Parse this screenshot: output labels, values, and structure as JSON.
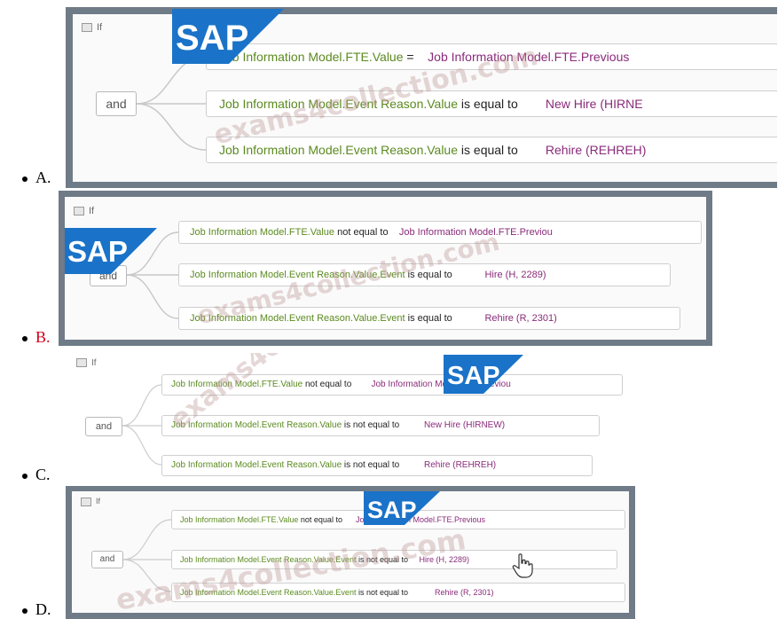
{
  "options": [
    {
      "letter": "A.",
      "if_label": "If",
      "and_label": "and",
      "rows": [
        {
          "field": "Job Information Model.FTE.Value",
          "op": " =",
          "value": "Job Information Model.FTE.Previous"
        },
        {
          "field": "Job Information Model.Event Reason.Value",
          "op": " is equal to",
          "value": "New Hire (HIRNE"
        },
        {
          "field": "Job Information Model.Event Reason.Value",
          "op": " is equal to",
          "value": "Rehire (REHREH)"
        }
      ]
    },
    {
      "letter": "B.",
      "if_label": "If",
      "and_label": "and",
      "rows": [
        {
          "field": "Job Information Model.FTE.Value",
          "op": " not equal to",
          "value": "Job Information Model.FTE.Previou"
        },
        {
          "field": "Job Information Model.Event Reason.Value.Event",
          "op": " is equal to",
          "value": "Hire (H, 2289)"
        },
        {
          "field": "Job Information Model.Event Reason.Value.Event",
          "op": " is equal to",
          "value": "Rehire (R, 2301)"
        }
      ]
    },
    {
      "letter": "C.",
      "if_label": "If",
      "and_label": "and",
      "rows": [
        {
          "field": "Job Information Model.FTE.Value",
          "op": " not equal to",
          "value": "Job Information Model.FTE.Previou"
        },
        {
          "field": "Job Information Model.Event Reason.Value",
          "op": " is not equal to",
          "value": "New Hire (HIRNEW)"
        },
        {
          "field": "Job Information Model.Event Reason.Value",
          "op": " is not equal to",
          "value": "Rehire (REHREH)"
        }
      ]
    },
    {
      "letter": "D.",
      "if_label": "If",
      "and_label": "and",
      "rows": [
        {
          "field": "Job Information Model.FTE.Value",
          "op": " not equal to",
          "value": "Job Information Model.FTE.Previous"
        },
        {
          "field": "Job Information Model.Event Reason.Value.Event",
          "op": " is not equal to",
          "value": "Hire (H, 2289)"
        },
        {
          "field": "Job Information Model.Event Reason.Value.Event",
          "op": " is not equal to",
          "value": "Rehire (R, 2301)"
        }
      ]
    }
  ],
  "logo_text": "SAP",
  "watermark": "exams4collection.com",
  "colors": {
    "selected_letter": "#d0021b",
    "field": "#5b8a1f",
    "value": "#8a2b7a",
    "frame": "#6f7b87",
    "sap_blue": "#1a73c8"
  }
}
